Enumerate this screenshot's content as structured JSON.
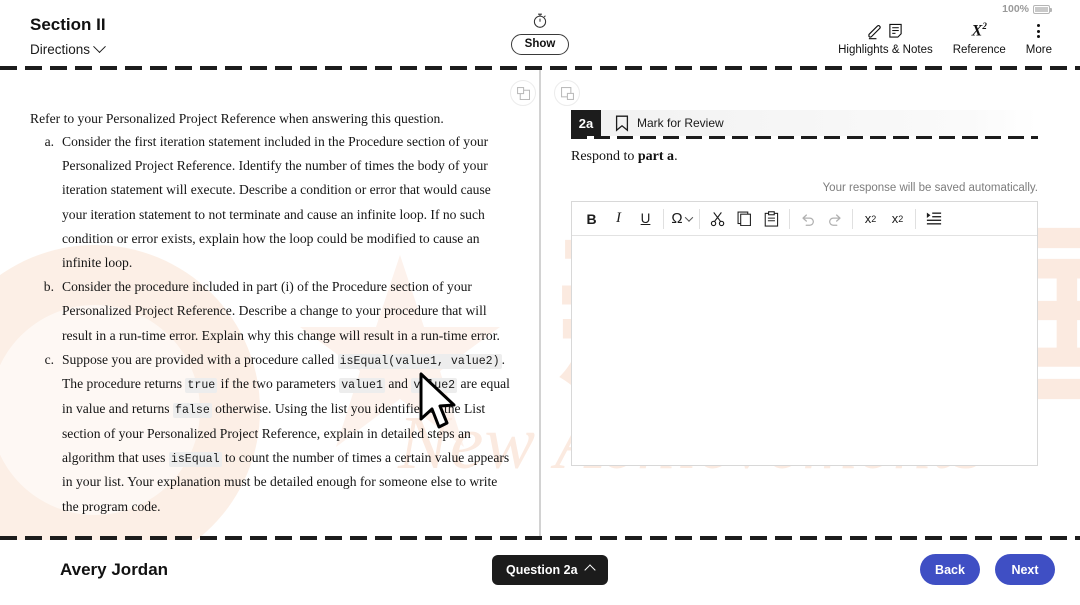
{
  "header": {
    "section_title": "Section II",
    "directions_label": "Directions",
    "directions_icon": "chevron-down-icon",
    "timer_icon": "stopwatch-icon",
    "show_button": "Show",
    "battery_percent": "100%",
    "battery_icon": "battery-full-icon",
    "tools": [
      {
        "label": "Highlights & Notes",
        "icons": [
          "highlighter-icon",
          "note-icon"
        ]
      },
      {
        "label": "Reference",
        "icons": [
          "x-squared-icon"
        ]
      },
      {
        "label": "More",
        "icons": [
          "kebab-menu-icon"
        ]
      }
    ]
  },
  "panel_controls": {
    "expand_left_icon": "expand-left-panel-icon",
    "expand_right_icon": "expand-right-panel-icon"
  },
  "question": {
    "intro": "Refer to your Personalized Project Reference when answering this question.",
    "parts": [
      {
        "marker": "a.",
        "segments": [
          {
            "type": "text",
            "value": "Consider the first iteration statement included in the Procedure section of your Personalized Project Reference. Identify the number of times the body of your iteration statement will execute. Describe a condition or error that would cause your iteration statement to not terminate and cause an infinite loop. If no such condition or error exists, explain how the loop could be modified to cause an infinite loop."
          }
        ]
      },
      {
        "marker": "b.",
        "segments": [
          {
            "type": "text",
            "value": "Consider the procedure included in part (i) of the Procedure section of your Personalized Project Reference. Describe a change to your procedure that will result in a run-time error. Explain why this change will result in a run-time error."
          }
        ]
      },
      {
        "marker": "c.",
        "segments": [
          {
            "type": "text",
            "value": "Suppose you are provided with a procedure called "
          },
          {
            "type": "code",
            "value": "isEqual(value1, value2)"
          },
          {
            "type": "text",
            "value": ". The procedure returns "
          },
          {
            "type": "code",
            "value": "true"
          },
          {
            "type": "text",
            "value": " if the two parameters "
          },
          {
            "type": "code",
            "value": "value1"
          },
          {
            "type": "text",
            "value": " and "
          },
          {
            "type": "code",
            "value": "value2"
          },
          {
            "type": "text",
            "value": " are equal in value and returns "
          },
          {
            "type": "code",
            "value": "false"
          },
          {
            "type": "text",
            "value": " otherwise. Using the list you identified in the List section of your Personalized Project Reference, explain in detailed steps an algorithm that uses "
          },
          {
            "type": "code",
            "value": "isEqual"
          },
          {
            "type": "text",
            "value": " to count the number of times a certain value appears in your list. Your explanation must be detailed enough for someone else to write the program code."
          }
        ]
      }
    ]
  },
  "answer": {
    "question_number": "2a",
    "mark_for_review": "Mark for Review",
    "bookmark_icon": "bookmark-icon",
    "respond_prefix": "Respond to ",
    "respond_bold": "part a",
    "respond_suffix": ".",
    "autosave_note": "Your response will be saved automatically.",
    "response_value": "",
    "toolbar": [
      {
        "name": "bold-button",
        "glyph": "B",
        "disabled": false
      },
      {
        "name": "italic-button",
        "glyph": "I",
        "disabled": false
      },
      {
        "name": "underline-button",
        "glyph": "U",
        "disabled": false
      },
      {
        "name": "special-character-button",
        "glyph": "Ω",
        "disabled": false
      },
      {
        "name": "cut-button",
        "glyph": "scissors-icon",
        "disabled": false
      },
      {
        "name": "copy-button",
        "glyph": "copy-icon",
        "disabled": false
      },
      {
        "name": "paste-button",
        "glyph": "paste-icon",
        "disabled": false
      },
      {
        "name": "undo-button",
        "glyph": "undo-icon",
        "disabled": true
      },
      {
        "name": "redo-button",
        "glyph": "redo-icon",
        "disabled": true
      },
      {
        "name": "superscript-button",
        "glyph": "x2-sup",
        "disabled": false
      },
      {
        "name": "subscript-button",
        "glyph": "x2-sub",
        "disabled": false
      },
      {
        "name": "indent-button",
        "glyph": "indent-icon",
        "disabled": false
      }
    ]
  },
  "footer": {
    "student_name": "Avery Jordan",
    "question_jump": "Question 2a",
    "question_jump_icon": "chevron-up-icon",
    "back_button": "Back",
    "next_button": "Next"
  },
  "watermark": {
    "cjk_text": "新橙国际",
    "latin_text": "New Achievements",
    "color": "#fbeae0"
  },
  "colors": {
    "accent_blue": "#3f4fc4",
    "dark": "#1c1c1c",
    "watermark": "#fbeae0"
  }
}
